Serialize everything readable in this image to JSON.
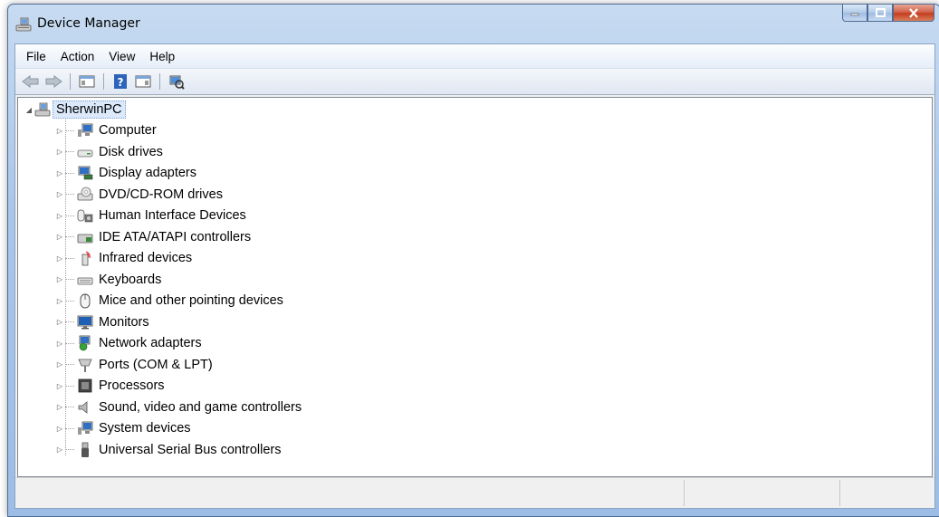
{
  "window": {
    "title": "Device Manager"
  },
  "menu": [
    "File",
    "Action",
    "View",
    "Help"
  ],
  "toolbar": [
    "back-icon",
    "forward-icon",
    "show-hide-console-tree-icon",
    "help-icon",
    "action-pane-icon",
    "scan-hardware-icon"
  ],
  "tree": {
    "root": "SherwinPC",
    "items": [
      {
        "label": "Computer",
        "icon": "computer-icon"
      },
      {
        "label": "Disk drives",
        "icon": "disk-drive-icon"
      },
      {
        "label": "Display adapters",
        "icon": "display-adapter-icon"
      },
      {
        "label": "DVD/CD-ROM drives",
        "icon": "dvd-drive-icon"
      },
      {
        "label": "Human Interface Devices",
        "icon": "hid-icon"
      },
      {
        "label": "IDE ATA/ATAPI controllers",
        "icon": "ide-controller-icon"
      },
      {
        "label": "Infrared devices",
        "icon": "infrared-icon"
      },
      {
        "label": "Keyboards",
        "icon": "keyboard-icon"
      },
      {
        "label": "Mice and other pointing devices",
        "icon": "mouse-icon"
      },
      {
        "label": "Monitors",
        "icon": "monitor-icon"
      },
      {
        "label": "Network adapters",
        "icon": "network-adapter-icon"
      },
      {
        "label": "Ports (COM & LPT)",
        "icon": "port-icon"
      },
      {
        "label": "Processors",
        "icon": "processor-icon"
      },
      {
        "label": "Sound, video and game controllers",
        "icon": "sound-icon"
      },
      {
        "label": "System devices",
        "icon": "system-devices-icon"
      },
      {
        "label": "Universal Serial Bus controllers",
        "icon": "usb-icon"
      }
    ]
  }
}
